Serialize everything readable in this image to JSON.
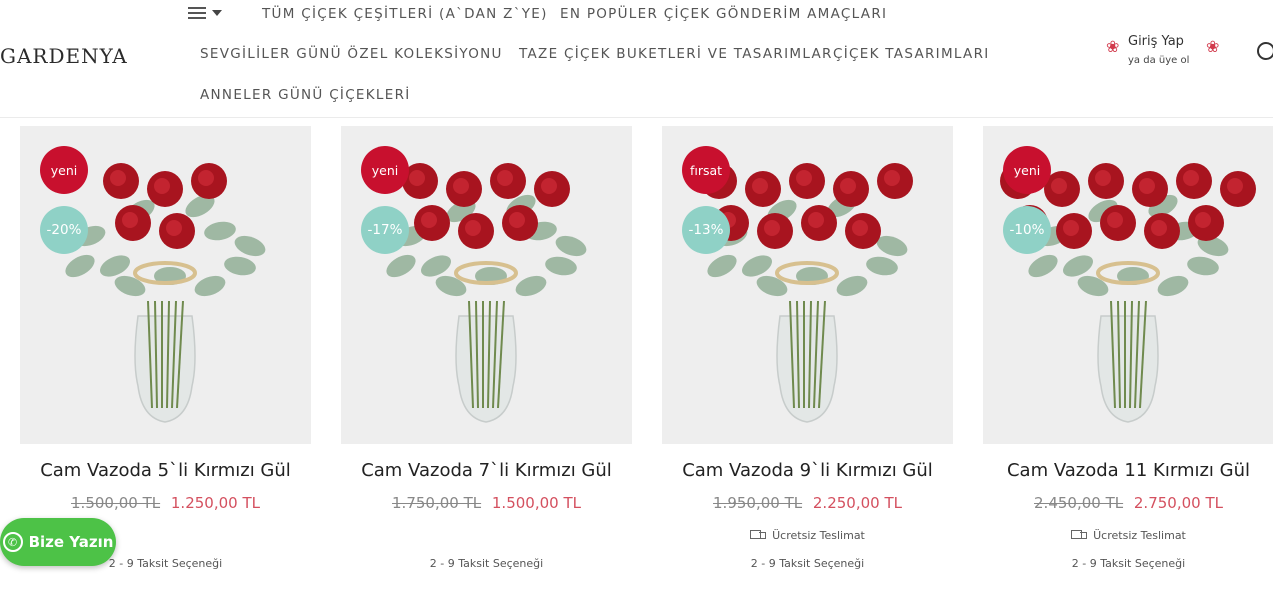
{
  "brand": {
    "logo_text": "GARDENYA"
  },
  "nav": {
    "items": [
      {
        "label": "TÜM ÇİÇEK ÇEŞİTLERİ (A`DAN Z`YE)"
      },
      {
        "label": "EN POPÜLER ÇİÇEK GÖNDERİM AMAÇLARI"
      },
      {
        "label": "SEVGİLİLER GÜNÜ ÖZEL KOLEKSİYONU"
      },
      {
        "label": "TAZE ÇİÇEK BUKETLERİ VE TASARIMLAR"
      },
      {
        "label": "ÇİÇEK TASARIMLARI"
      },
      {
        "label": "ANNELER GÜNÜ ÇİÇEKLERİ"
      }
    ]
  },
  "account": {
    "login_label": "Giriş Yap",
    "register_label": "ya da üye ol"
  },
  "colors": {
    "badge": "#c8102e",
    "discount": "#8fd1c6",
    "new_price": "#d4505f",
    "whatsapp": "#4dc247"
  },
  "products": [
    {
      "badge": "yeni",
      "discount": "-20%",
      "title": "Cam Vazoda 5`li Kırmızı Gül",
      "old_price": "1.500,00 TL",
      "price": "1.250,00 TL",
      "free_shipping": "",
      "installments": "2 - 9 Taksit Seçeneği",
      "roses": 5
    },
    {
      "badge": "yeni",
      "discount": "-17%",
      "title": "Cam Vazoda 7`li Kırmızı Gül",
      "old_price": "1.750,00 TL",
      "price": "1.500,00 TL",
      "free_shipping": "",
      "installments": "2 - 9 Taksit Seçeneği",
      "roses": 7
    },
    {
      "badge": "fırsat",
      "discount": "-13%",
      "title": "Cam Vazoda 9`li Kırmızı Gül",
      "old_price": "1.950,00 TL",
      "price": "2.250,00 TL",
      "free_shipping": "Ücretsiz Teslimat",
      "installments": "2 - 9 Taksit Seçeneği",
      "roses": 9
    },
    {
      "badge": "yeni",
      "discount": "-10%",
      "title": "Cam Vazoda 11 Kırmızı Gül",
      "old_price": "2.450,00 TL",
      "price": "2.750,00 TL",
      "free_shipping": "Ücretsiz Teslimat",
      "installments": "2 - 9 Taksit Seçeneği",
      "roses": 11
    }
  ],
  "whatsapp": {
    "label": "Bize Yazın"
  }
}
